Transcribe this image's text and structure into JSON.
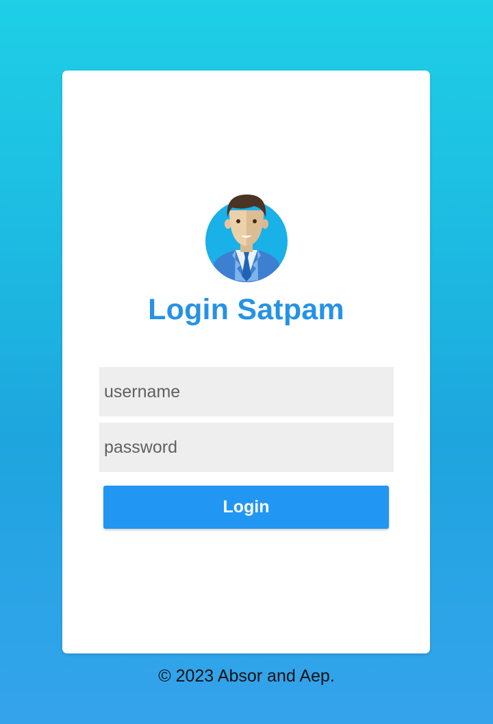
{
  "login": {
    "title": "Login Satpam",
    "username_placeholder": "username",
    "password_placeholder": "password",
    "button_label": "Login"
  },
  "footer": {
    "text": "© 2023 Absor and Aep."
  },
  "colors": {
    "accent": "#2196f3",
    "title": "#2592e6",
    "field_bg": "#eeeeee",
    "card_bg": "#ffffff"
  },
  "icons": {
    "avatar": "businessman-avatar-icon"
  }
}
